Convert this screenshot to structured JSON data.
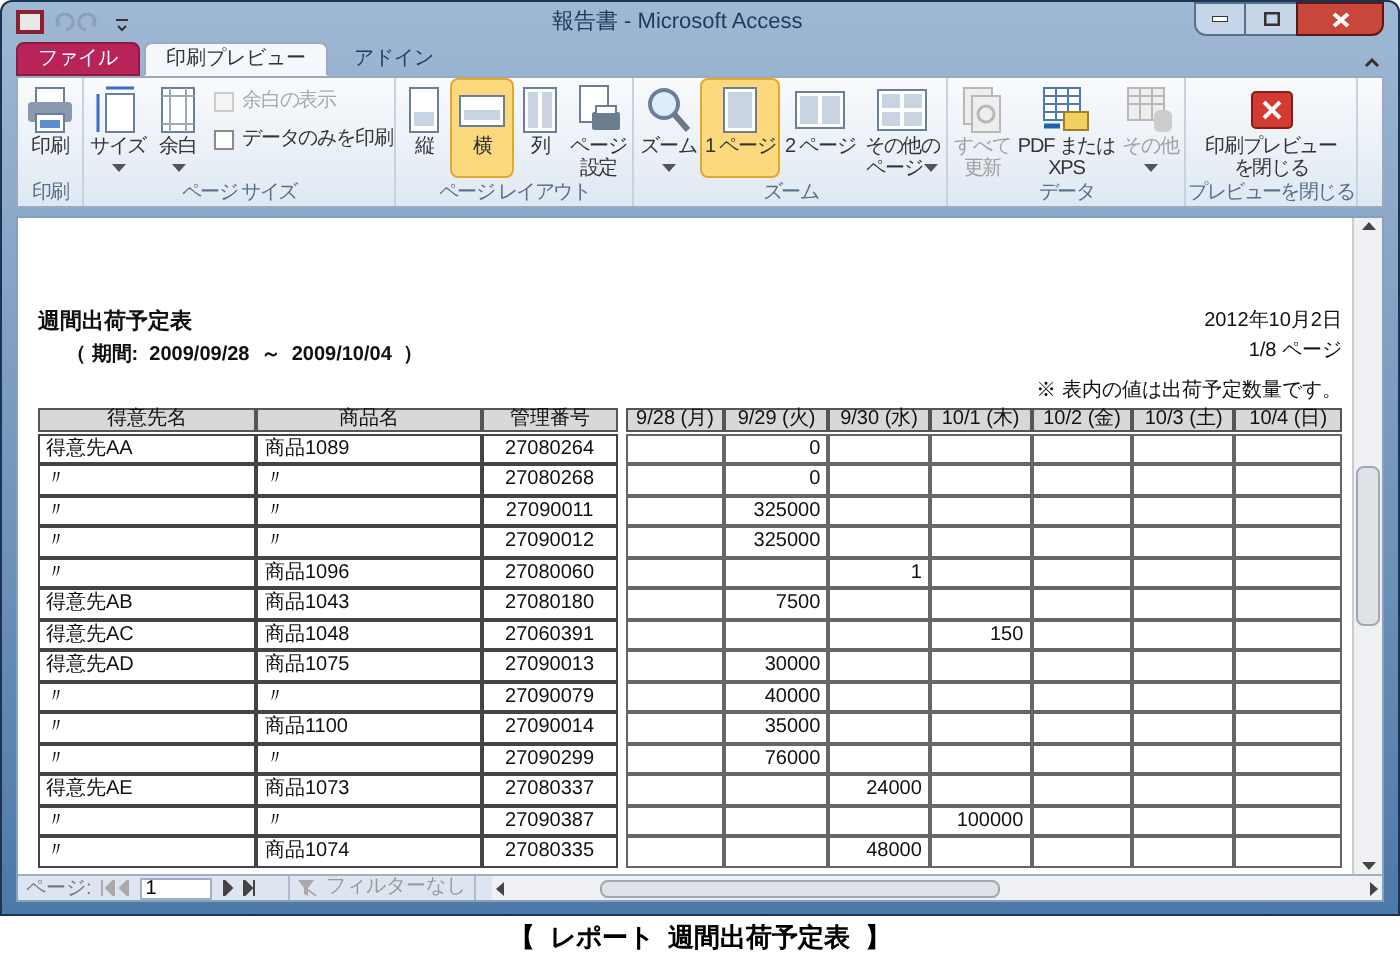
{
  "window": {
    "title": "報告書 - Microsoft Access"
  },
  "tabs": [
    {
      "label": "ファイル",
      "kind": "file",
      "selected": false
    },
    {
      "label": "印刷プレビュー",
      "kind": "tab",
      "selected": true
    },
    {
      "label": "アドイン",
      "kind": "tab",
      "selected": false
    }
  ],
  "ribbon": [
    {
      "label": "印刷",
      "items": [
        {
          "kind": "big",
          "label": "印刷",
          "selected": false,
          "disabled": false,
          "dropdown": false
        }
      ]
    },
    {
      "label": "ページ サイズ",
      "items": [
        {
          "kind": "big",
          "label": "サイズ",
          "selected": false,
          "disabled": false,
          "dropdown": true
        },
        {
          "kind": "big",
          "label": "余白",
          "selected": false,
          "disabled": false,
          "dropdown": true
        },
        {
          "kind": "checks",
          "checks": [
            {
              "label": "余白の表示",
              "checked": false,
              "disabled": true
            },
            {
              "label": "データのみを印刷",
              "checked": false,
              "disabled": false
            }
          ]
        }
      ]
    },
    {
      "label": "ページ レイアウト",
      "items": [
        {
          "kind": "big",
          "label": "縦",
          "selected": false,
          "disabled": false,
          "dropdown": false
        },
        {
          "kind": "big",
          "label": "横",
          "selected": true,
          "disabled": false,
          "dropdown": false
        },
        {
          "kind": "big",
          "label": "列",
          "selected": false,
          "disabled": false,
          "dropdown": false
        },
        {
          "kind": "big",
          "label": "ページ設定",
          "selected": false,
          "disabled": false,
          "dropdown": false
        }
      ]
    },
    {
      "label": "ズーム",
      "items": [
        {
          "kind": "big",
          "label": "ズーム",
          "selected": false,
          "disabled": false,
          "dropdown": true
        },
        {
          "kind": "big",
          "label": "1 ページ",
          "selected": true,
          "disabled": false,
          "dropdown": false
        },
        {
          "kind": "big",
          "label": "2 ページ",
          "selected": false,
          "disabled": false,
          "dropdown": false
        },
        {
          "kind": "big",
          "label": "その他のページ",
          "selected": false,
          "disabled": false,
          "dropdown": true
        }
      ]
    },
    {
      "label": "データ",
      "items": [
        {
          "kind": "big",
          "label": "すべて更新",
          "selected": false,
          "disabled": true,
          "dropdown": false
        },
        {
          "kind": "big",
          "label": "PDF または XPS",
          "selected": false,
          "disabled": false,
          "dropdown": false
        },
        {
          "kind": "big",
          "label": "その他",
          "selected": false,
          "disabled": true,
          "dropdown": true
        }
      ]
    },
    {
      "label": "プレビューを閉じる",
      "items": [
        {
          "kind": "big",
          "label": "印刷プレビューを閉じる",
          "selected": false,
          "disabled": false,
          "dropdown": false
        }
      ]
    }
  ],
  "report": {
    "title": "週間出荷予定表",
    "period": "（ 期間:  2009/09/28  ～  2009/10/04  ）",
    "date": "2012年10月2日",
    "page": "1/8 ページ",
    "note": "※ 表内の値は出荷予定数量です。",
    "columns": [
      "得意先名",
      "商品名",
      "管理番号"
    ],
    "days": [
      "9/28 (月)",
      "9/29 (火)",
      "9/30 (水)",
      "10/1 (木)",
      "10/2 (金)",
      "10/3 (土)",
      "10/4 (日)"
    ],
    "rows": [
      {
        "customer": "得意先AA",
        "product": "商品1089",
        "number": "27080264",
        "day_2": "0"
      },
      {
        "customer": "〃",
        "product": "〃",
        "number": "27080268",
        "day_2": "0"
      },
      {
        "customer": "〃",
        "product": "〃",
        "number": "27090011",
        "day_2": "325000"
      },
      {
        "customer": "〃",
        "product": "〃",
        "number": "27090012",
        "day_2": "325000"
      },
      {
        "customer": "〃",
        "product": "商品1096",
        "number": "27080060",
        "day_3": "1"
      },
      {
        "customer": "得意先AB",
        "product": "商品1043",
        "number": "27080180",
        "day_2": "7500"
      },
      {
        "customer": "得意先AC",
        "product": "商品1048",
        "number": "27060391",
        "day_4": "150"
      },
      {
        "customer": "得意先AD",
        "product": "商品1075",
        "number": "27090013",
        "day_2": "30000"
      },
      {
        "customer": "〃",
        "product": "〃",
        "number": "27090079",
        "day_2": "40000"
      },
      {
        "customer": "〃",
        "product": "商品1100",
        "number": "27090014",
        "day_2": "35000"
      },
      {
        "customer": "〃",
        "product": "〃",
        "number": "27090299",
        "day_2": "76000"
      },
      {
        "customer": "得意先AE",
        "product": "商品1073",
        "number": "27080337",
        "day_3": "24000"
      },
      {
        "customer": "〃",
        "product": "〃",
        "number": "27090387",
        "day_4": "100000"
      },
      {
        "customer": "〃",
        "product": "商品1074",
        "number": "27080335",
        "day_3": "48000"
      }
    ]
  },
  "status_bar": {
    "page_label": "ページ:",
    "page_value": "1",
    "filter": "フィルターなし"
  },
  "caption": "【  レポート  週間出荷予定表  】"
}
